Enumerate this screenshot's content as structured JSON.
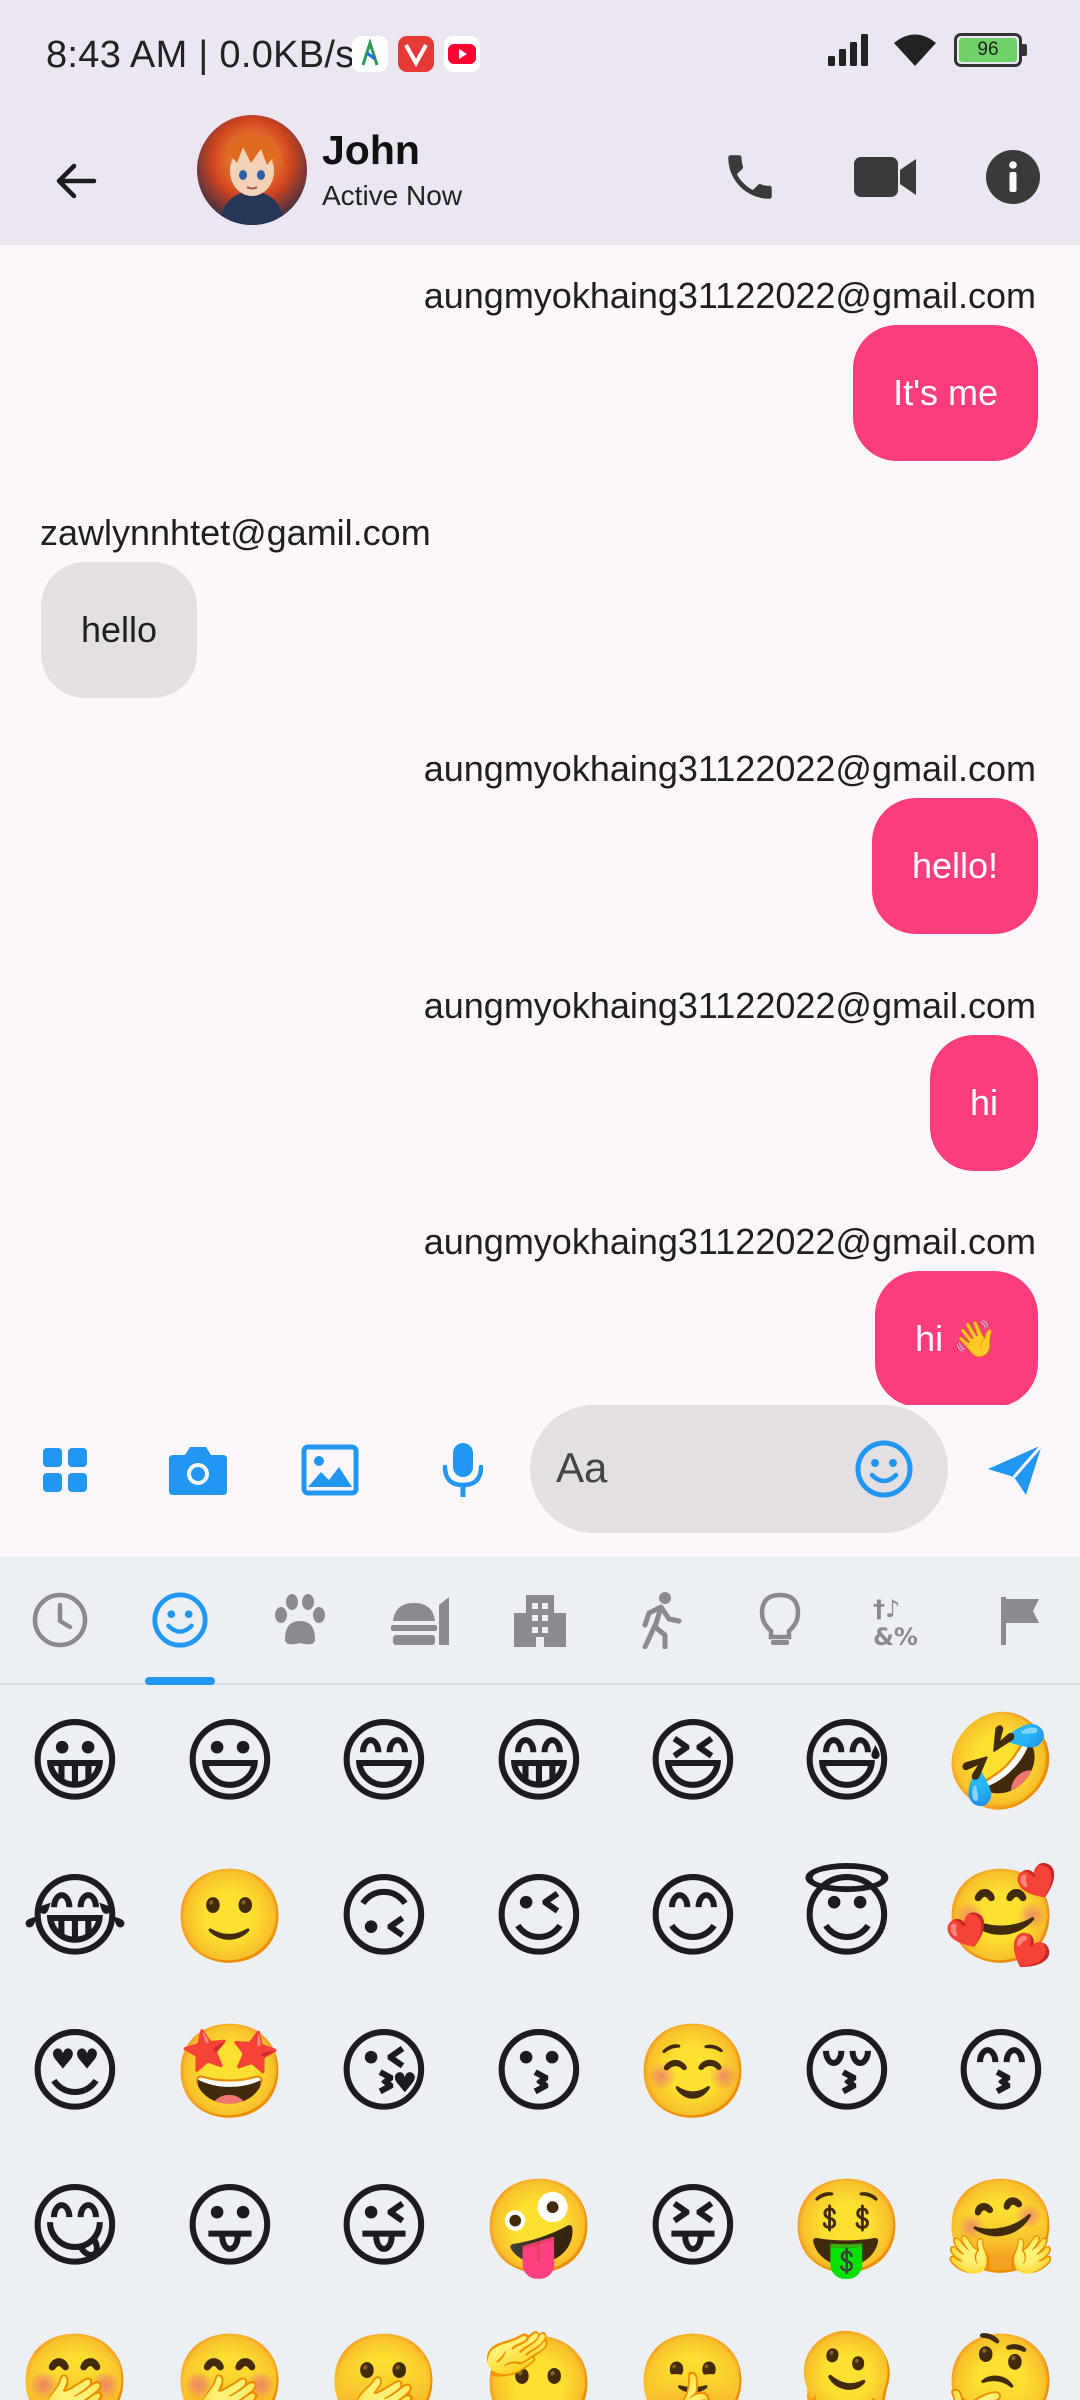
{
  "status_bar": {
    "time": "8:43 AM | 0.0KB/s",
    "battery": "96",
    "app_badges": [
      "location-app-icon",
      "vidmate-app-icon",
      "youtube-app-icon"
    ]
  },
  "header": {
    "name": "John",
    "status": "Active Now",
    "icons": [
      "back-arrow-icon",
      "phone-icon",
      "video-camera-icon",
      "info-icon"
    ]
  },
  "messages": [
    {
      "sender": "aungmyokhaing31122022@gmail.com",
      "text": "It's me",
      "direction": "outgoing"
    },
    {
      "sender": "zawlynnhtet@gamil.com",
      "text": "hello",
      "direction": "incoming"
    },
    {
      "sender": "aungmyokhaing31122022@gmail.com",
      "text": "hello!",
      "direction": "outgoing"
    },
    {
      "sender": "aungmyokhaing31122022@gmail.com",
      "text": "hi",
      "direction": "outgoing"
    },
    {
      "sender": "aungmyokhaing31122022@gmail.com",
      "text": "hi 👋",
      "direction": "outgoing"
    }
  ],
  "composer": {
    "placeholder": "Aa",
    "icons": [
      "apps-grid-icon",
      "camera-icon",
      "image-icon",
      "microphone-icon",
      "smiley-icon",
      "send-icon"
    ]
  },
  "emoji_keyboard": {
    "categories": [
      "recent-icon",
      "smileys-icon",
      "animals-icon",
      "food-icon",
      "buildings-icon",
      "activity-icon",
      "objects-icon",
      "symbols-icon",
      "flags-icon"
    ],
    "selected_category": "smileys-icon",
    "emojis": [
      [
        "😀",
        "😃",
        "😄",
        "😁",
        "😆",
        "😅",
        "🤣"
      ],
      [
        "😂",
        "🙂",
        "🙃",
        "😉",
        "😊",
        "😇",
        "🥰"
      ],
      [
        "😍",
        "🤩",
        "😘",
        "😗",
        "☺️",
        "😚",
        "😙"
      ],
      [
        "😋",
        "😛",
        "😜",
        "🤪",
        "😝",
        "🤑",
        "🤗"
      ],
      [
        "🤭",
        "🤭",
        "🫢",
        "🫡",
        "🤫",
        "🫠",
        "🤔"
      ]
    ]
  },
  "colors": {
    "accent_blue": "#2196f3",
    "outgoing_bubble": "#fc3d7c",
    "incoming_bubble": "#e4dfe3",
    "header_bg": "#ece6f3"
  }
}
